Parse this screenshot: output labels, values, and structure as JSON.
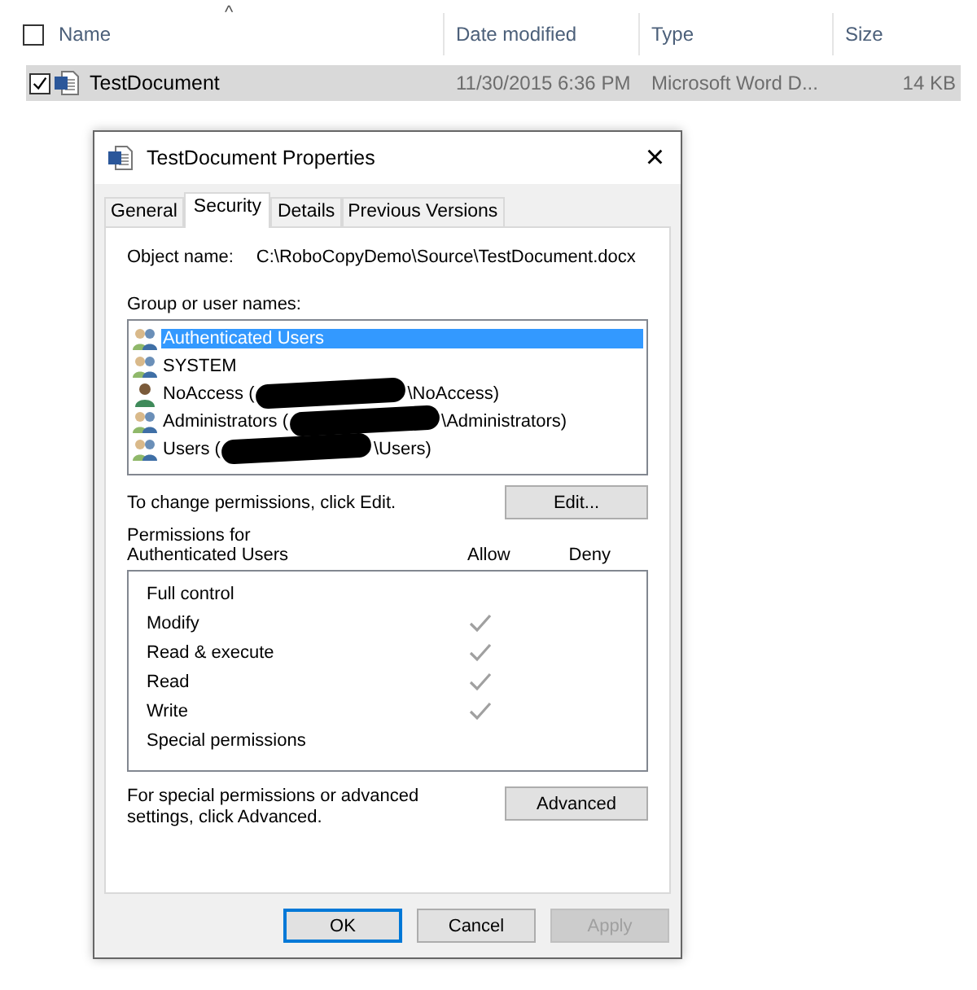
{
  "explorer": {
    "header_checked": false,
    "sort_indicator": "^",
    "columns": [
      "Name",
      "Date modified",
      "Type",
      "Size"
    ],
    "rows": [
      {
        "name": "TestDocument",
        "date_modified": "11/30/2015 6:36 PM",
        "type": "Microsoft Word D...",
        "size": "14 KB",
        "checked": true,
        "selected": true
      }
    ]
  },
  "dialog": {
    "title": "TestDocument Properties",
    "close": "×",
    "tabs": [
      {
        "label": "General",
        "selected": false
      },
      {
        "label": "Security",
        "selected": true
      },
      {
        "label": "Details",
        "selected": false
      },
      {
        "label": "Previous Versions",
        "selected": false
      }
    ],
    "object_name_label": "Object name:",
    "object_name": "C:\\RoboCopyDemo\\Source\\TestDocument.docx",
    "group_label": "Group or user names:",
    "groups": [
      {
        "kind": "group",
        "name": "Authenticated Users",
        "selected": true
      },
      {
        "kind": "group",
        "name": "SYSTEM",
        "selected": false
      },
      {
        "kind": "user",
        "name": "NoAccess (",
        "redacted": true,
        "suffix": "\\NoAccess)",
        "selected": false
      },
      {
        "kind": "group",
        "name": "Administrators (",
        "redacted": true,
        "suffix": "\\Administrators)",
        "selected": false
      },
      {
        "kind": "group",
        "name": "Users (",
        "redacted": true,
        "suffix": "\\Users)",
        "selected": false
      }
    ],
    "edit_hint": "To change permissions, click Edit.",
    "edit_button": "Edit...",
    "permissions_label": "Permissions for Authenticated Users",
    "allow_heading": "Allow",
    "deny_heading": "Deny",
    "permissions": [
      {
        "name": "Full control",
        "allow": false,
        "deny": false
      },
      {
        "name": "Modify",
        "allow": true,
        "deny": false
      },
      {
        "name": "Read & execute",
        "allow": true,
        "deny": false
      },
      {
        "name": "Read",
        "allow": true,
        "deny": false
      },
      {
        "name": "Write",
        "allow": true,
        "deny": false
      },
      {
        "name": "Special permissions",
        "allow": false,
        "deny": false
      }
    ],
    "advanced_hint": "For special permissions or advanced settings, click Advanced.",
    "advanced_button": "Advanced",
    "buttons": [
      {
        "label": "OK",
        "kind": "default"
      },
      {
        "label": "Cancel",
        "kind": "normal"
      },
      {
        "label": "Apply",
        "kind": "disabled"
      }
    ]
  }
}
